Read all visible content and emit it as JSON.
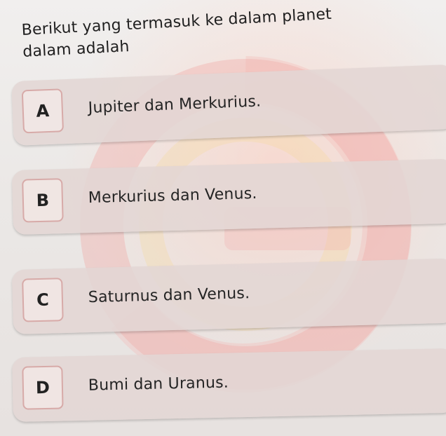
{
  "question": {
    "line1": "Berikut yang termasuk ke dalam planet",
    "line2": "dalam adalah"
  },
  "options": [
    {
      "letter": "A",
      "text": "Jupiter dan Merkurius."
    },
    {
      "letter": "B",
      "text": "Merkurius dan Venus."
    },
    {
      "letter": "C",
      "text": "Saturnus dan Venus."
    },
    {
      "letter": "D",
      "text": "Bumi dan Uranus."
    }
  ],
  "colors": {
    "background": "#e9e6e4",
    "option_background": "#e2d6d4",
    "letter_border": "#d7aaa8",
    "watermark_red": "#f2a3a1",
    "watermark_yellow": "#f6d98f"
  }
}
